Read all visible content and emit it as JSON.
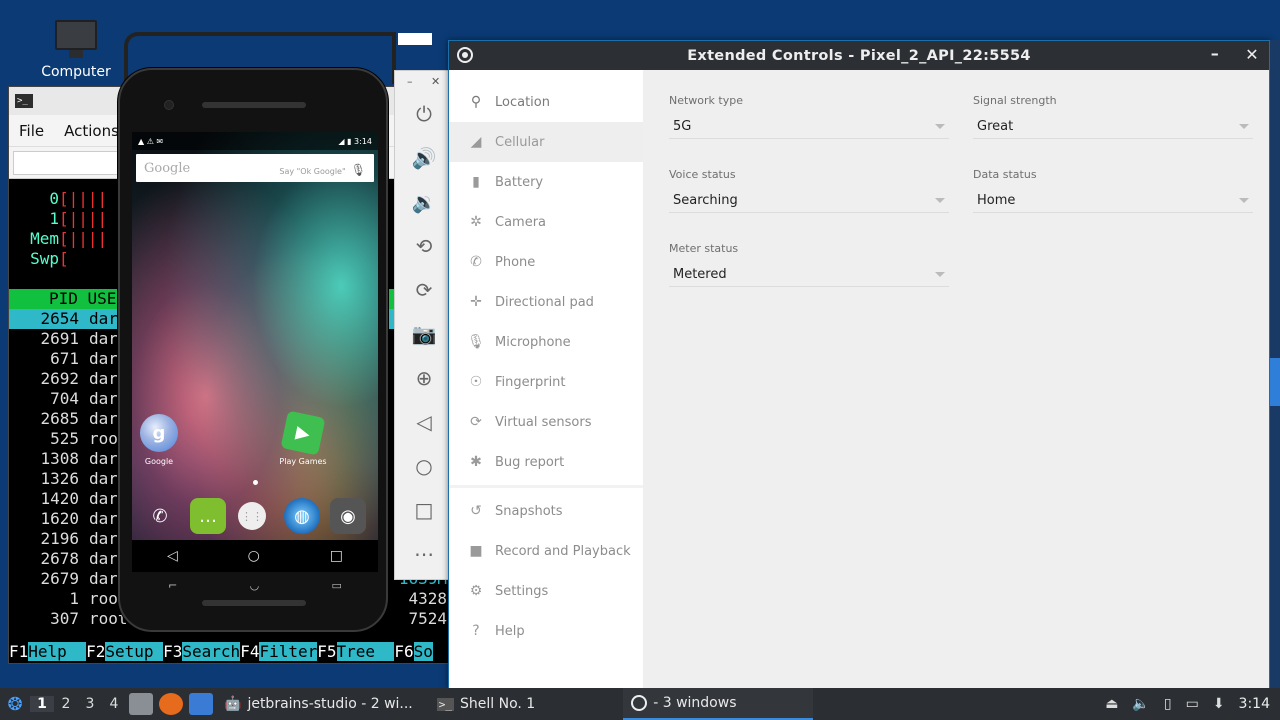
{
  "desktop": {
    "computer_label": "Computer"
  },
  "terminal": {
    "menu": [
      "File",
      "Actions"
    ],
    "meters": [
      {
        "label": "0",
        "bar": "[||||"
      },
      {
        "label": "1",
        "bar": "[||||"
      },
      {
        "label": "Mem",
        "bar": "[||||"
      },
      {
        "label": "Swp",
        "bar": "["
      }
    ],
    "header": "PID USE",
    "rows": [
      {
        "pid": "2654",
        "user": "dar"
      },
      {
        "pid": "2691",
        "user": "dar"
      },
      {
        "pid": "671",
        "user": "dar"
      },
      {
        "pid": "2692",
        "user": "dar"
      },
      {
        "pid": "704",
        "user": "dar"
      },
      {
        "pid": "2685",
        "user": "dar"
      },
      {
        "pid": "525",
        "user": "roo"
      },
      {
        "pid": "1308",
        "user": "dar"
      },
      {
        "pid": "1326",
        "user": "dar"
      },
      {
        "pid": "1420",
        "user": "dar"
      },
      {
        "pid": "1620",
        "user": "dar"
      },
      {
        "pid": "2196",
        "user": "dar"
      },
      {
        "pid": "2678",
        "user": "dar"
      },
      {
        "pid": "2679",
        "user": "dar"
      },
      {
        "pid": "1",
        "user": "roo"
      },
      {
        "pid": "307",
        "user": "root"
      }
    ],
    "right_values": [
      "1639M",
      "4328",
      "7524"
    ],
    "fkeys": [
      {
        "key": "F1",
        "label": "Help  "
      },
      {
        "key": "F2",
        "label": "Setup "
      },
      {
        "key": "F3",
        "label": "Search"
      },
      {
        "key": "F4",
        "label": "Filter"
      },
      {
        "key": "F5",
        "label": "Tree  "
      },
      {
        "key": "F6",
        "label": "So"
      }
    ]
  },
  "phone": {
    "status_time": "3:14",
    "search_logo": "Google",
    "search_hint": "Say \"Ok Google\"",
    "apps": [
      {
        "name": "Google",
        "glyph": "g",
        "color": "#4a7fd8"
      },
      {
        "name": "Play Games",
        "glyph": "▶",
        "color": "#3fbf4f"
      }
    ],
    "dock": [
      {
        "icon": "phone-icon",
        "glyph": "✆",
        "color": "#1f8fe8"
      },
      {
        "icon": "messages-icon",
        "glyph": "…",
        "color": "#7fbf2f"
      },
      {
        "icon": "app-drawer-icon",
        "glyph": "⋮⋮",
        "color": "#eeeeee"
      },
      {
        "icon": "browser-icon",
        "glyph": "◍",
        "color": "#1e6fbf"
      },
      {
        "icon": "camera-icon",
        "glyph": "◉",
        "color": "#555555"
      }
    ],
    "nav": [
      "◁",
      "○",
      "□"
    ]
  },
  "ext": {
    "title": "Extended Controls - Pixel_2_API_22:5554",
    "nav": [
      {
        "label": "Location",
        "icon": "location-icon",
        "glyph": "⚲"
      },
      {
        "label": "Cellular",
        "icon": "cellular-icon",
        "glyph": "◢"
      },
      {
        "label": "Battery",
        "icon": "battery-icon",
        "glyph": "▮"
      },
      {
        "label": "Camera",
        "icon": "camera-icon",
        "glyph": "✲"
      },
      {
        "label": "Phone",
        "icon": "phone-icon",
        "glyph": "✆"
      },
      {
        "label": "Directional pad",
        "icon": "dpad-icon",
        "glyph": "✛"
      },
      {
        "label": "Microphone",
        "icon": "microphone-icon",
        "glyph": "🎙"
      },
      {
        "label": "Fingerprint",
        "icon": "fingerprint-icon",
        "glyph": "☉"
      },
      {
        "label": "Virtual sensors",
        "icon": "sensors-icon",
        "glyph": "⟳"
      },
      {
        "label": "Bug report",
        "icon": "bug-icon",
        "glyph": "✱"
      },
      {
        "label": "Snapshots",
        "icon": "snapshots-icon",
        "glyph": "↺"
      },
      {
        "label": "Record and Playback",
        "icon": "record-icon",
        "glyph": "■"
      },
      {
        "label": "Settings",
        "icon": "settings-icon",
        "glyph": "⚙"
      },
      {
        "label": "Help",
        "icon": "help-icon",
        "glyph": "?"
      }
    ],
    "fields": {
      "network_type": {
        "label": "Network type",
        "value": "5G"
      },
      "signal_strength": {
        "label": "Signal strength",
        "value": "Great"
      },
      "voice_status": {
        "label": "Voice status",
        "value": "Searching"
      },
      "data_status": {
        "label": "Data status",
        "value": "Home"
      },
      "meter_status": {
        "label": "Meter status",
        "value": "Metered"
      }
    }
  },
  "taskbar": {
    "workspaces": [
      "1",
      "2",
      "3",
      "4"
    ],
    "tasks": [
      {
        "label": "jetbrains-studio - 2 wi...",
        "icon": "android-icon"
      },
      {
        "label": "Shell No. 1",
        "icon": "terminal-icon"
      },
      {
        "label": "- 3 windows",
        "icon": "emulator-icon"
      }
    ],
    "clock": "3:14"
  }
}
